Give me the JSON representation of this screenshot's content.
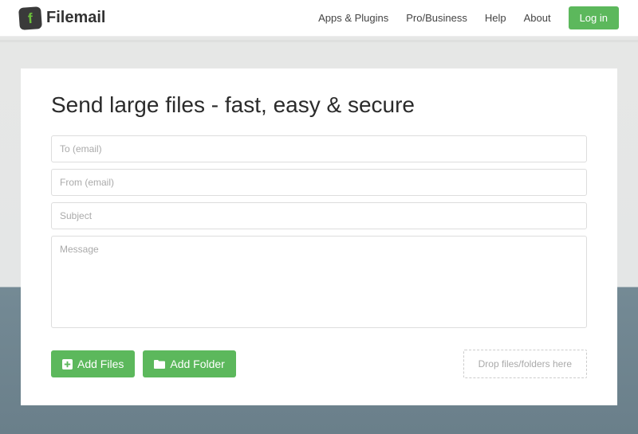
{
  "brand": "Filemail",
  "nav": {
    "apps": "Apps & Plugins",
    "pro": "Pro/Business",
    "help": "Help",
    "about": "About",
    "login": "Log in"
  },
  "form": {
    "heading": "Send large files - fast, easy & secure",
    "to_placeholder": "To (email)",
    "from_placeholder": "From (email)",
    "subject_placeholder": "Subject",
    "message_placeholder": "Message"
  },
  "actions": {
    "add_files": "Add Files",
    "add_folder": "Add Folder",
    "dropzone": "Drop files/folders here"
  }
}
